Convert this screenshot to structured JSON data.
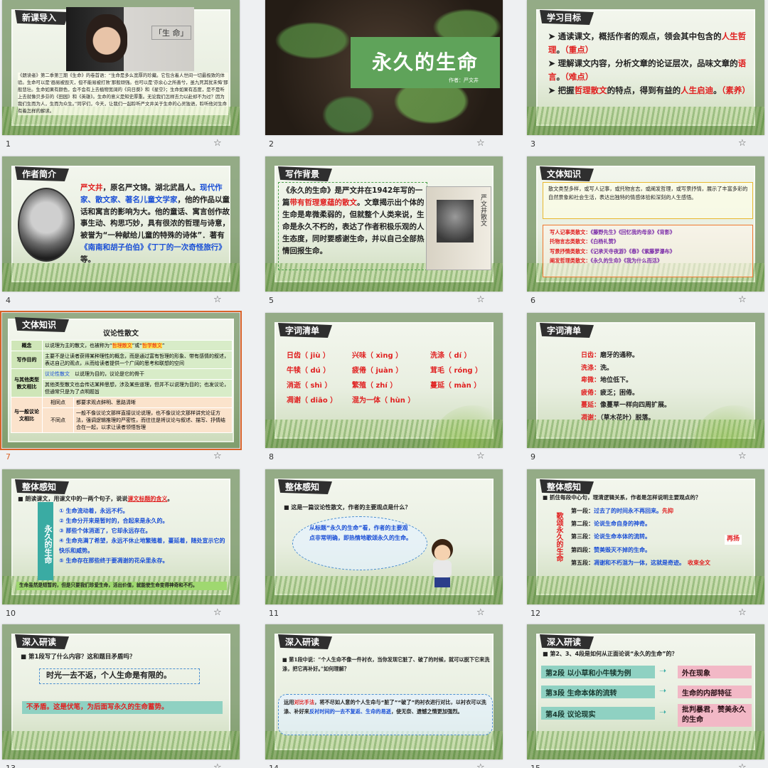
{
  "slides": [
    {
      "num": "1",
      "tag": "新课导入",
      "video_text": "「生 命」",
      "body": "《朗读者》第二季第三期《生命》的卷首语：“生命是多么宽厚的珍藏。它包含着人世间一切最极致的体验。生命可以是‘画易被毁灭，但不能易被打败’那般顽强。也可以是‘亦余心之所善兮，虽九死其犹未悔’那般悲壮。生命如果有颜色，会不会有上去植物宽阔的《向日葵》和《星空》；生命如果有态度，是不是听上去就像贝多芬的《田园》和《英雄》。生命的意义是知史厚重。无论我们怎样去力以赴却不为过？因为我们生而为人，生而为众生。”同学们，今天，让我们一起聆听严文井关于生命的心灵独语，聆听他对生命有着怎样的解读。"
    },
    {
      "num": "2",
      "title": "永久的生命",
      "author": "作者：严文井"
    },
    {
      "num": "3",
      "tag": "学习目标",
      "items": [
        {
          "pre": "通读课文，概括作者的观点，领会其中包含的",
          "em": "人生哲理",
          "post": "。",
          "mark": "（重点）"
        },
        {
          "pre": "理解课文内容，分析文章的论证层次，品味文章的",
          "em": "语言",
          "post": "。",
          "mark": "（难点）"
        },
        {
          "pre": "把握",
          "em": "哲理散文",
          "post": "的特点，得到有益的",
          "em2": "人生启迪",
          "post2": "。",
          "mark": "（素养）"
        }
      ]
    },
    {
      "num": "4",
      "tag": "作者简介",
      "name": "严文井",
      "p1": "，原名严文锦。湖北武昌人。",
      "roles": "现代作家、散文家、著名儿童文学家",
      "p2": "，他的作品以童话和寓言的影响为大。他的童话、寓言创作故事生动、构思巧妙，具有很浓的哲理与诗意，被誉为“一种献给儿童的特殊的诗体”．著有",
      "works": "《南南和胡子伯伯》《丁丁的一次奇怪旅行》",
      "p3": "等。"
    },
    {
      "num": "5",
      "tag": "写作背景",
      "p1": "《永久的生命》是严文井在1942年写的一篇",
      "em": "带有哲理意蕴的散文",
      "p2": "。文章揭示出个体的生命是卑微柔弱的，但就整个人类来说，生命是永久不朽的，表达了作者积极乐观的人生态度，同时要感谢生命，并以自己全部热情回报生命。",
      "book_label": "严文井散文"
    },
    {
      "num": "6",
      "tag": "文体知识",
      "intro": "散文类型多样，或写人记事，或托物言志，或阐发哲理，或写景抒情，展示了丰富多彩的自然景象和社会生活，表达出独特的情感体验和深刻的人生感悟。",
      "rows": [
        {
          "k": "写人记事类散文：",
          "v": "《藤野先生》《回忆我的母亲》《背影》"
        },
        {
          "k": "托物言志类散文：",
          "v": "《白杨礼赞》"
        },
        {
          "k": "写景抒情类散文：",
          "v": "《记承天寺夜游》《春》《紫藤萝瀑布》"
        },
        {
          "k": "阐发哲理类散文：",
          "v": "《永久的生命》《我为什么而活》"
        }
      ]
    },
    {
      "num": "7",
      "tag": "文体知识",
      "table_title": "议论性散文",
      "r1k": "概念",
      "r1v": "以说理为主的散文，也被称为“",
      "r1e1": "哲理散文",
      "r1m": "”或“",
      "r1e2": "哲学散文",
      "r1t": "”",
      "r2k": "写作目的",
      "r2v": "主要不是让读者获得某种理性的概念，而是通过富有哲理的形象、带有感情的叙述，表达自己的观点，从而给读者提供一个广阔的思考和联想的空间",
      "r3k": "与其他类型散文相比",
      "r3a": "议论性散文",
      "r3av": "以说理为目的，议论是它的骨干",
      "r3b": "其他类型散文也会传达某种思想，涉及某些道理，但并不以说理为目的；也发议论，但通常只是为了点明题旨",
      "r4k": "与一般议论文相比",
      "r4a": "相同点",
      "r4av": "都要求观点鲜明、思路清晰",
      "r4b": "不同点",
      "r4bv": "一般不像议论文那样直接议论说理，也不像议论文那样讲究论证方法，强调逻辑推理的严密性，而往往是将议论与叙述、描写、抒情结合在一起，以求让读者领悟哲理"
    },
    {
      "num": "8",
      "tag": "字词清单",
      "words": [
        [
          "日齿（ jiù ）",
          "兴味（ xìng ）",
          "洗涤（ dí ）"
        ],
        [
          "牛犊（ dú ）",
          "疲倦（ juàn ）",
          "茸毛（ róng ）"
        ],
        [
          "消逝（ shì ）",
          "繁殖（ zhí ）",
          "蔓延（ màn ）"
        ],
        [
          "凋谢（ diāo ）",
          "混为一体（ hùn ）",
          ""
        ]
      ]
    },
    {
      "num": "9",
      "tag": "字词清单",
      "defs": [
        {
          "w": "日齿：",
          "d": "磨牙的通称。"
        },
        {
          "w": "洗涤：",
          "d": "洗。"
        },
        {
          "w": "卑微：",
          "d": "地位低下。"
        },
        {
          "w": "疲倦：",
          "d": "疲乏；困倦。"
        },
        {
          "w": "蔓延：",
          "d": "像蔓草一样向四周扩展。"
        },
        {
          "w": "凋谢：",
          "d": "（草木花叶）脱落。"
        }
      ]
    },
    {
      "num": "10",
      "tag": "整体感知",
      "q": "朗读课文，用课文中的一两个句子，说说",
      "qe": "课文标题的含义",
      "qp": "。",
      "bar": "永久的生命",
      "pts": [
        "① 生命流动着，永远不朽。",
        "② 生命分开来是暂时的，合起来是永久的。",
        "③ 那些个体消逝了，它却永远存在。",
        "④ 生命充满了希望，永远不休止地繁殖着，蔓延着，随处宣示它的快乐和威势。",
        "⑤ 生命存在那些终于要凋谢的花朵里永存。"
      ],
      "foot": "生命虽然是短暂的，但是只要我们珍爱生命，活出价值，就能使生命变得神奇和不朽。"
    },
    {
      "num": "11",
      "tag": "整体感知",
      "q": "这是一篇议论性散文，作者的主要观点是什么？",
      "a": "从标题“永久的生命”看，作者的主要观点非常明确，即热情地歌颂永久的生命。"
    },
    {
      "num": "12",
      "tag": "整体感知",
      "q": "抓住每段中心句，理清逻辑关系，作者是怎样说明主要观点的？",
      "side": "歌颂永久的生命",
      "paras": [
        {
          "k": "第一段：",
          "v": "过去了的时间永不再回来。",
          "tag": "先抑"
        },
        {
          "k": "第二段：",
          "v": "论说生命自身的神奇。",
          "tag": ""
        },
        {
          "k": "第三段：",
          "v": "论说生命本体的流转。",
          "tag": ""
        },
        {
          "k": "第四段：",
          "v": "赞美毁灭不掉的生命。",
          "tag": ""
        },
        {
          "k": "第五段：",
          "v": "凋谢和不朽混为一体，这就是奇迹。",
          "tag": "收束全文"
        }
      ],
      "mid_tag": "再扬"
    },
    {
      "num": "13",
      "tag": "深入研读",
      "q": "第1段写了什么内容？这和题目矛盾吗？",
      "a1": "时光一去不返，个人生命是有限的。",
      "a2": "不矛盾。这是伏笔，为后面写永久的生命蓄势。"
    },
    {
      "num": "14",
      "tag": "深入研读",
      "q": "第1段中说：“个人生命不像一件衬衣，当你发现它脏了、破了的时候，就可以脱下它来洗涤，把它再补好。”如何理解？",
      "a": "运用",
      "a_em": "对比手法",
      "a2": "，将不尽如人意的个人生命与“脏了”“破了”的衬衣进行对比，以衬衣可以洗涤、补好来",
      "a_em2": "反衬时间的一去不复返、生命的易逝",
      "a3": "，使无奈、遗憾之情更加强烈。"
    },
    {
      "num": "15",
      "tag": "深入研读",
      "q": "第2、3、4段是如何从正面论说“永久的生命”的？",
      "rows": [
        {
          "l": "第2段 以小草和小牛犊为例",
          "r": "外在现象"
        },
        {
          "l": "第3段 生命本体的流转",
          "r": "生命的内部特征"
        },
        {
          "l": "第4段 议论现实",
          "r": "批判暴君，赞美永久的生命"
        }
      ]
    }
  ],
  "ui": {
    "star_icon": "☆",
    "selected_slide": "7",
    "accent": "#d9632a"
  }
}
